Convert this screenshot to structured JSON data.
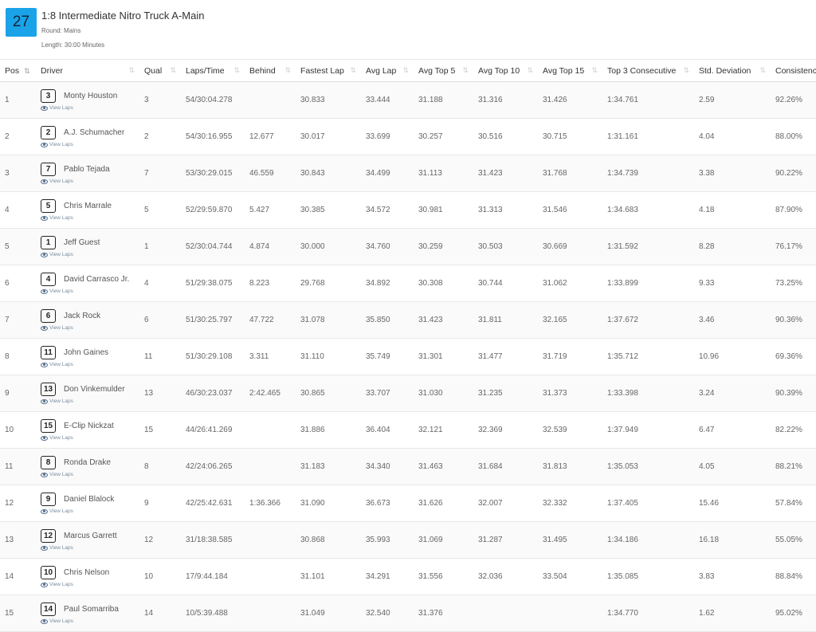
{
  "race": {
    "heat_number": "27",
    "title": "1:8 Intermediate Nitro Truck A-Main",
    "round": "Round: Mains",
    "length": "Length: 30:00 Minutes"
  },
  "table": {
    "headers": {
      "pos": "Pos",
      "driver": "Driver",
      "qual": "Qual",
      "laps_time": "Laps/Time",
      "behind": "Behind",
      "fastest_lap": "Fastest Lap",
      "avg_lap": "Avg Lap",
      "avg_top5": "Avg Top 5",
      "avg_top10": "Avg Top 10",
      "avg_top15": "Avg Top 15",
      "top3_consecutive": "Top 3 Consecutive",
      "std_deviation": "Std. Deviation",
      "consistency": "Consistency"
    },
    "view_laps_label": "View Laps",
    "rows": [
      {
        "pos": "1",
        "car": "3",
        "driver": "Monty Houston",
        "qual": "3",
        "laps_time": "54/30:04.278",
        "behind": "",
        "fastest_lap": "30.833",
        "avg_lap": "33.444",
        "avg_top5": "31.188",
        "avg_top10": "31.316",
        "avg_top15": "31.426",
        "top3_consecutive": "1:34.761",
        "std_deviation": "2.59",
        "consistency": "92.26%"
      },
      {
        "pos": "2",
        "car": "2",
        "driver": "A.J. Schumacher",
        "qual": "2",
        "laps_time": "54/30:16.955",
        "behind": "12.677",
        "fastest_lap": "30.017",
        "avg_lap": "33.699",
        "avg_top5": "30.257",
        "avg_top10": "30.516",
        "avg_top15": "30.715",
        "top3_consecutive": "1:31.161",
        "std_deviation": "4.04",
        "consistency": "88.00%"
      },
      {
        "pos": "3",
        "car": "7",
        "driver": "Pablo Tejada",
        "qual": "7",
        "laps_time": "53/30:29.015",
        "behind": "46.559",
        "fastest_lap": "30.843",
        "avg_lap": "34.499",
        "avg_top5": "31.113",
        "avg_top10": "31.423",
        "avg_top15": "31.768",
        "top3_consecutive": "1:34.739",
        "std_deviation": "3.38",
        "consistency": "90.22%"
      },
      {
        "pos": "4",
        "car": "5",
        "driver": "Chris Marrale",
        "qual": "5",
        "laps_time": "52/29:59.870",
        "behind": "5.427",
        "fastest_lap": "30.385",
        "avg_lap": "34.572",
        "avg_top5": "30.981",
        "avg_top10": "31.313",
        "avg_top15": "31.546",
        "top3_consecutive": "1:34.683",
        "std_deviation": "4.18",
        "consistency": "87.90%"
      },
      {
        "pos": "5",
        "car": "1",
        "driver": "Jeff Guest",
        "qual": "1",
        "laps_time": "52/30:04.744",
        "behind": "4.874",
        "fastest_lap": "30.000",
        "avg_lap": "34.760",
        "avg_top5": "30.259",
        "avg_top10": "30.503",
        "avg_top15": "30.669",
        "top3_consecutive": "1:31.592",
        "std_deviation": "8.28",
        "consistency": "76.17%"
      },
      {
        "pos": "6",
        "car": "4",
        "driver": "David Carrasco Jr.",
        "qual": "4",
        "laps_time": "51/29:38.075",
        "behind": "8.223",
        "fastest_lap": "29.768",
        "avg_lap": "34.892",
        "avg_top5": "30.308",
        "avg_top10": "30.744",
        "avg_top15": "31.062",
        "top3_consecutive": "1:33.899",
        "std_deviation": "9.33",
        "consistency": "73.25%"
      },
      {
        "pos": "7",
        "car": "6",
        "driver": "Jack Rock",
        "qual": "6",
        "laps_time": "51/30:25.797",
        "behind": "47.722",
        "fastest_lap": "31.078",
        "avg_lap": "35.850",
        "avg_top5": "31.423",
        "avg_top10": "31.811",
        "avg_top15": "32.165",
        "top3_consecutive": "1:37.672",
        "std_deviation": "3.46",
        "consistency": "90.36%"
      },
      {
        "pos": "8",
        "car": "11",
        "driver": "John Gaines",
        "qual": "11",
        "laps_time": "51/30:29.108",
        "behind": "3.311",
        "fastest_lap": "31.110",
        "avg_lap": "35.749",
        "avg_top5": "31.301",
        "avg_top10": "31.477",
        "avg_top15": "31.719",
        "top3_consecutive": "1:35.712",
        "std_deviation": "10.96",
        "consistency": "69.36%"
      },
      {
        "pos": "9",
        "car": "13",
        "driver": "Don Vinkemulder",
        "qual": "13",
        "laps_time": "46/30:23.037",
        "behind": "2:42.465",
        "fastest_lap": "30.865",
        "avg_lap": "33.707",
        "avg_top5": "31.030",
        "avg_top10": "31.235",
        "avg_top15": "31.373",
        "top3_consecutive": "1:33.398",
        "std_deviation": "3.24",
        "consistency": "90.39%"
      },
      {
        "pos": "10",
        "car": "15",
        "driver": "E-Clip Nickzat",
        "qual": "15",
        "laps_time": "44/26:41.269",
        "behind": "",
        "fastest_lap": "31.886",
        "avg_lap": "36.404",
        "avg_top5": "32.121",
        "avg_top10": "32.369",
        "avg_top15": "32.539",
        "top3_consecutive": "1:37.949",
        "std_deviation": "6.47",
        "consistency": "82.22%"
      },
      {
        "pos": "11",
        "car": "8",
        "driver": "Ronda Drake",
        "qual": "8",
        "laps_time": "42/24:06.265",
        "behind": "",
        "fastest_lap": "31.183",
        "avg_lap": "34.340",
        "avg_top5": "31.463",
        "avg_top10": "31.684",
        "avg_top15": "31.813",
        "top3_consecutive": "1:35.053",
        "std_deviation": "4.05",
        "consistency": "88.21%"
      },
      {
        "pos": "12",
        "car": "9",
        "driver": "Daniel Blalock",
        "qual": "9",
        "laps_time": "42/25:42.631",
        "behind": "1:36.366",
        "fastest_lap": "31.090",
        "avg_lap": "36.673",
        "avg_top5": "31.626",
        "avg_top10": "32.007",
        "avg_top15": "32.332",
        "top3_consecutive": "1:37.405",
        "std_deviation": "15.46",
        "consistency": "57.84%"
      },
      {
        "pos": "13",
        "car": "12",
        "driver": "Marcus Garrett",
        "qual": "12",
        "laps_time": "31/18:38.585",
        "behind": "",
        "fastest_lap": "30.868",
        "avg_lap": "35.993",
        "avg_top5": "31.069",
        "avg_top10": "31.287",
        "avg_top15": "31.495",
        "top3_consecutive": "1:34.186",
        "std_deviation": "16.18",
        "consistency": "55.05%"
      },
      {
        "pos": "14",
        "car": "10",
        "driver": "Chris Nelson",
        "qual": "10",
        "laps_time": "17/9:44.184",
        "behind": "",
        "fastest_lap": "31.101",
        "avg_lap": "34.291",
        "avg_top5": "31.556",
        "avg_top10": "32.036",
        "avg_top15": "33.504",
        "top3_consecutive": "1:35.085",
        "std_deviation": "3.83",
        "consistency": "88.84%"
      },
      {
        "pos": "15",
        "car": "14",
        "driver": "Paul Somarriba",
        "qual": "14",
        "laps_time": "10/5:39.488",
        "behind": "",
        "fastest_lap": "31.049",
        "avg_lap": "32.540",
        "avg_top5": "31.376",
        "avg_top10": "",
        "avg_top15": "",
        "top3_consecutive": "1:34.770",
        "std_deviation": "1.62",
        "consistency": "95.02%"
      }
    ]
  }
}
